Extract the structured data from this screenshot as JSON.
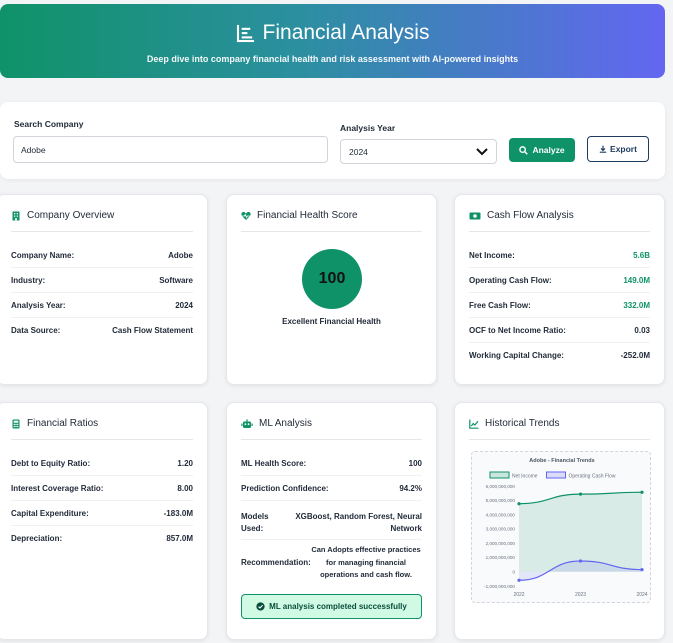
{
  "hero": {
    "title": "Financial Analysis",
    "subtitle": "Deep dive into company financial health and risk assessment with AI-powered insights"
  },
  "search": {
    "company_label": "Search Company",
    "company_value": "Adobe",
    "year_label": "Analysis Year",
    "year_value": "2024",
    "analyze_label": "Analyze",
    "export_label": "Export"
  },
  "overview": {
    "title": "Company Overview",
    "rows": [
      {
        "label": "Company Name:",
        "value": "Adobe"
      },
      {
        "label": "Industry:",
        "value": "Software"
      },
      {
        "label": "Analysis Year:",
        "value": "2024"
      },
      {
        "label": "Data Source:",
        "value": "Cash Flow Statement"
      }
    ]
  },
  "health": {
    "title": "Financial Health Score",
    "score": "100",
    "label": "Excellent Financial Health"
  },
  "cashflow": {
    "title": "Cash Flow Analysis",
    "rows": [
      {
        "label": "Net Income:",
        "value": "5.6B"
      },
      {
        "label": "Operating Cash Flow:",
        "value": "149.0M"
      },
      {
        "label": "Free Cash Flow:",
        "value": "332.0M"
      },
      {
        "label": "OCF to Net Income Ratio:",
        "value": "0.03"
      },
      {
        "label": "Working Capital Change:",
        "value": "-252.0M"
      }
    ]
  },
  "ratios": {
    "title": "Financial Ratios",
    "rows": [
      {
        "label": "Debt to Equity Ratio:",
        "value": "1.20"
      },
      {
        "label": "Interest Coverage Ratio:",
        "value": "8.00"
      },
      {
        "label": "Capital Expenditure:",
        "value": "-183.0M"
      },
      {
        "label": "Depreciation:",
        "value": "857.0M"
      }
    ]
  },
  "ml": {
    "title": "ML Analysis",
    "health_label": "ML Health Score:",
    "health_value": "100",
    "confidence_label": "Prediction Confidence:",
    "confidence_value": "94.2%",
    "models_label": "Models Used:",
    "models_value": "XGBoost, Random Forest, Neural Network",
    "recommendation_label": "Recommendation:",
    "recommendation_value": "Can Adopts effective practices for managing financial operations and cash flow.",
    "success_message": "ML analysis completed successfully"
  },
  "trends": {
    "title": "Historical Trends"
  },
  "chart_data": {
    "type": "line",
    "title": "Adobe - Financial Trends",
    "x": [
      "2022",
      "2023",
      "2024"
    ],
    "series": [
      {
        "name": "Net Income",
        "color": "#0f9268",
        "values": [
          4760000000,
          5430000000,
          5560000000
        ]
      },
      {
        "name": "Operating Cash Flow",
        "color": "#6366f1",
        "values": [
          -600000000,
          750000000,
          149000000
        ]
      }
    ],
    "ylim": [
      -1000000000,
      6000000000
    ],
    "yticks": [
      "6,000,000,000",
      "5,000,000,000",
      "4,000,000,000",
      "3,000,000,000",
      "2,000,000,000",
      "1,000,000,000",
      "0",
      "-1,000,000,000"
    ],
    "legend": "top",
    "grid": false
  }
}
